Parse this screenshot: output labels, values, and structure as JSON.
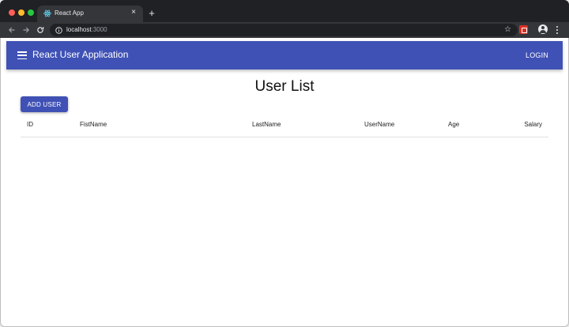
{
  "browser": {
    "tab": {
      "title": "React App",
      "close_glyph": "×"
    },
    "new_tab_glyph": "+",
    "address": {
      "host": "localhost",
      "port": ":3000"
    },
    "icons": {
      "back": "arrow-left-icon",
      "forward": "arrow-right-icon",
      "reload": "reload-icon",
      "info": "info-icon",
      "bookmark": "star-icon",
      "extension": "extension-icon",
      "profile": "profile-icon",
      "menu": "kebab-menu-icon"
    }
  },
  "appbar": {
    "title": "React User Application",
    "login_label": "LOGIN",
    "color": "#3f51b5"
  },
  "page": {
    "title": "User List",
    "add_user_label": "ADD USER"
  },
  "table": {
    "columns": [
      "ID",
      "FistName",
      "LastName",
      "UserName",
      "Age",
      "Salary"
    ],
    "rows": []
  }
}
